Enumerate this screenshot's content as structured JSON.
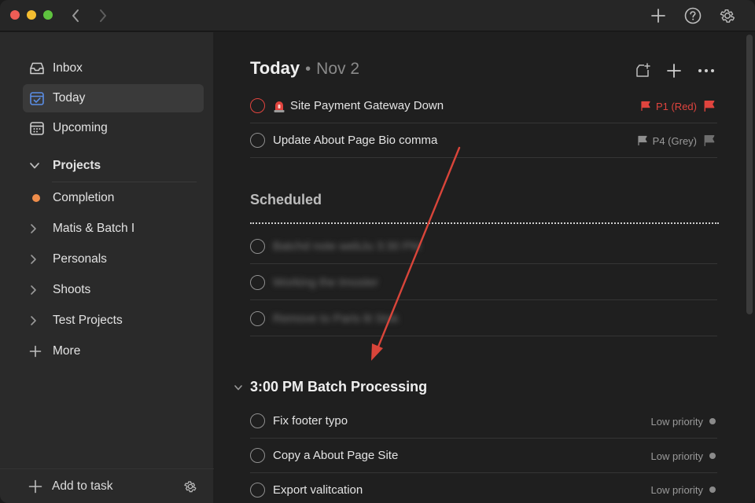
{
  "sidebar": {
    "items": [
      {
        "label": "Inbox",
        "icon": "inbox-icon"
      },
      {
        "label": "Today",
        "icon": "calendar-today-icon",
        "active": true
      },
      {
        "label": "Upcoming",
        "icon": "calendar-icon"
      }
    ],
    "projects_label": "Projects",
    "projects": [
      {
        "label": "Completion",
        "icon": "dot-icon",
        "color": "#ef8d4b"
      },
      {
        "label": "Matis & Batch I",
        "icon": "chevron-right-icon"
      },
      {
        "label": "Personals",
        "icon": "chevron-right-icon"
      },
      {
        "label": "Shoots",
        "icon": "chevron-right-icon"
      },
      {
        "label": "Test Projects",
        "icon": "chevron-right-icon"
      }
    ],
    "more_label": "More",
    "footer": {
      "add_label": "Add to task"
    }
  },
  "header": {
    "title": "Today",
    "separator": "•",
    "date": "Nov 2"
  },
  "today_tasks": [
    {
      "emoji": "🚨",
      "name": "Site Payment Gateway Down",
      "priority": "P1 (Red)",
      "priority_color": "#e0443e"
    },
    {
      "name": "Update About Page Bio comma",
      "priority": "P4 (Grey)",
      "priority_color": "#9a9a9a"
    }
  ],
  "scheduled": {
    "title": "Scheduled",
    "tasks": [
      {
        "name": "Batchd note webJu 3:30 PM"
      },
      {
        "name": "Working the tmoster"
      },
      {
        "name": "Remove to Paris lit Stok"
      }
    ]
  },
  "batch": {
    "title": "3:00 PM Batch Processing",
    "tasks": [
      {
        "name": "Fix footer typo",
        "priority": "Low priority"
      },
      {
        "name": "Copy a About Page Site",
        "priority": "Low priority"
      },
      {
        "name": "Export valitcation",
        "priority": "Low priority"
      }
    ]
  },
  "colors": {
    "accent_red": "#e0443e",
    "annotation_arrow": "#d9453a",
    "project_dot": "#ef8d4b",
    "today_icon": "#5b8ee6"
  }
}
